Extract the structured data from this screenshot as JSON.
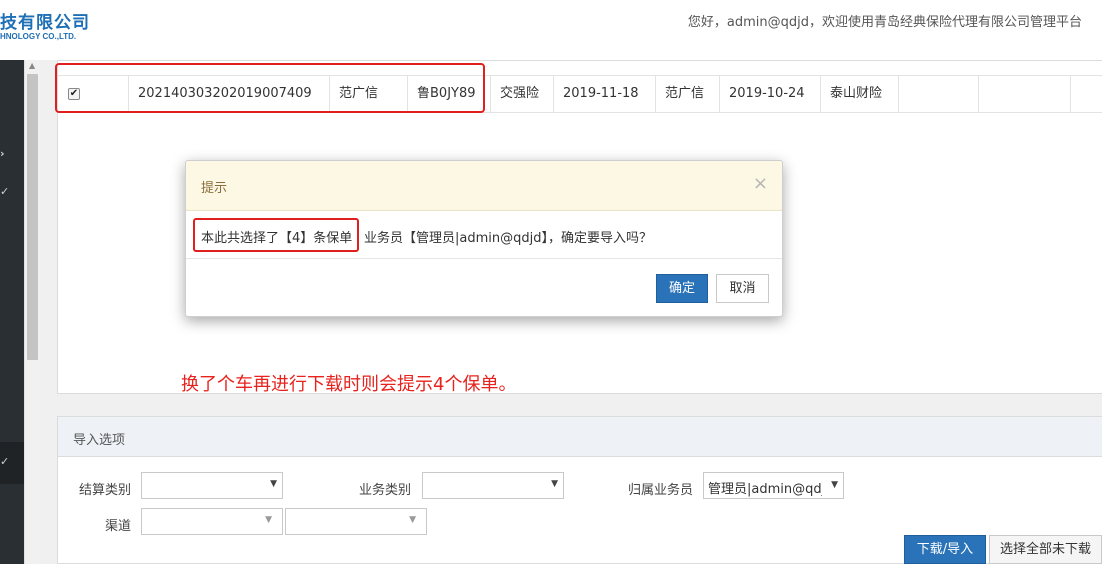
{
  "header": {
    "logo_cn": "技有限公司",
    "logo_en": "HNOLOGY CO.,LTD.",
    "welcome": "您好，admin@qdjd，欢迎使用青岛经典保险代理有限公司管理平台"
  },
  "sidebar": {
    "icons": [
      "chevron-right-icon",
      "chevron-down-icon",
      "chevron-down-icon"
    ]
  },
  "grid": {
    "row": {
      "checked": true,
      "checkmark": "✔",
      "cells": [
        "20214030320201900740​9",
        "范广信",
        "鲁B0JY89",
        "交强险",
        "2019-11-18",
        "范广信",
        "2019-10-24",
        "泰山财险",
        "",
        "",
        ""
      ]
    }
  },
  "annotation": "换了个车再进行下载时则会提示4个保单。",
  "options": {
    "title": "导入选项",
    "settlement_label": "结算类别",
    "settlement_value": "",
    "business_label": "业务类别",
    "business_value": "",
    "salesman_label": "归属业务员",
    "salesman_value": "管理员|admin@qdjd",
    "channel_label": "渠道",
    "channel_value_1": "",
    "channel_value_2": "",
    "download_button": "下载/导入",
    "select_all_button": "选择全部未下载"
  },
  "modal": {
    "title": "提示",
    "close": "×",
    "message_part1": "本此共选择了【4】条保单",
    "message_part2": "业务员【管理员|admin@qdjd】，确定要导入吗？",
    "ok": "确定",
    "cancel": "取消"
  },
  "colors": {
    "accent": "#2b73b8",
    "highlight_red": "#e0201f",
    "annotation_red": "#e8231d",
    "modal_header": "#fcf8e4",
    "sidebar": "#2a2f33"
  }
}
